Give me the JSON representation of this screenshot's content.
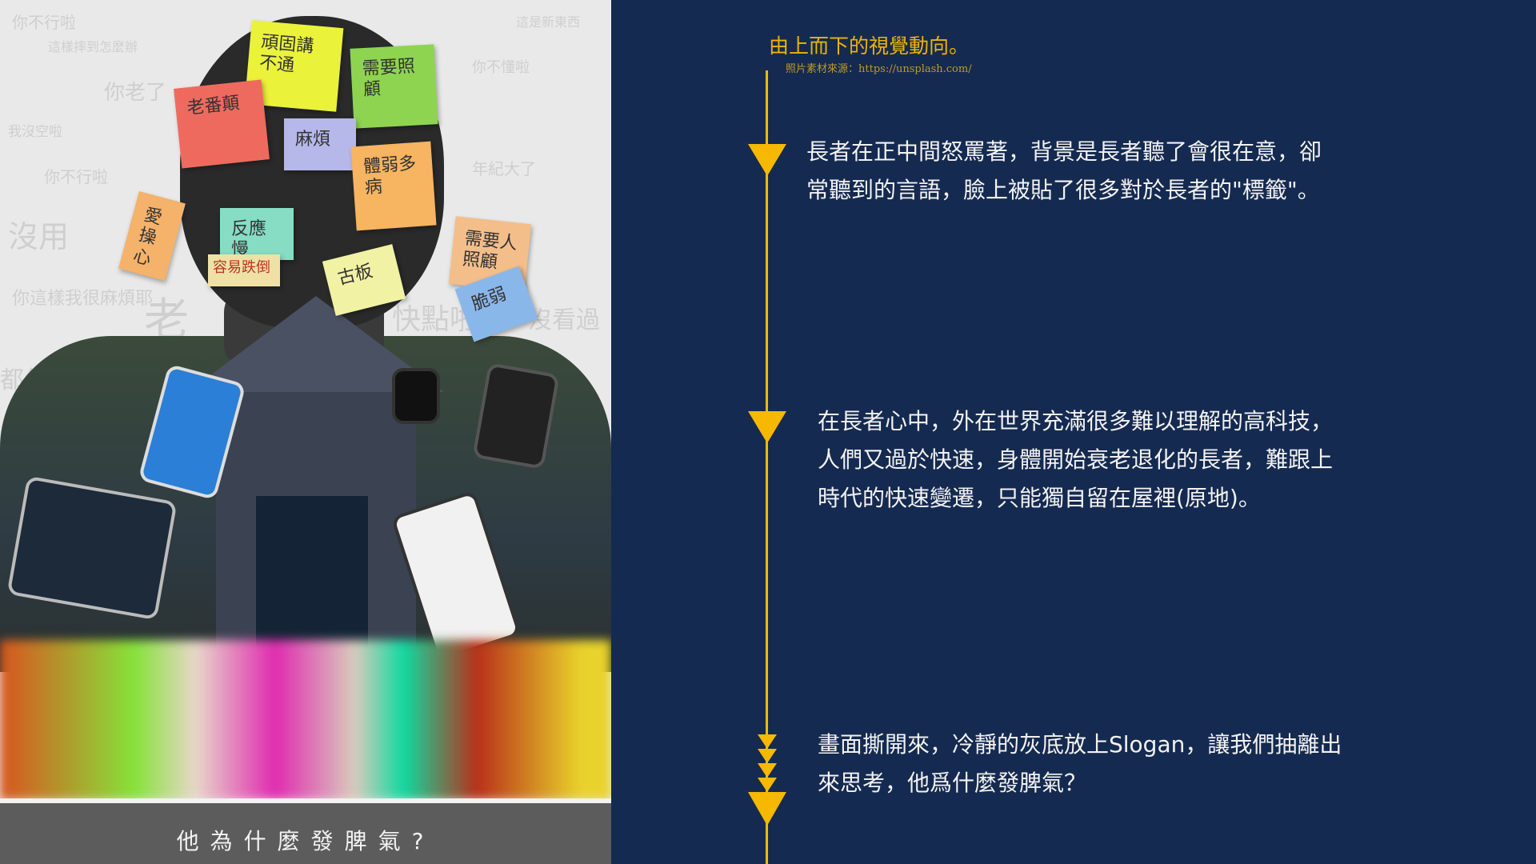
{
  "header": {
    "title": "由上而下的視覺動向。",
    "credit": "照片素材來源：https://unsplash.com/"
  },
  "steps": [
    {
      "lines": [
        "長者在正中間怒罵著，背景是長者聽了會很在意，卻",
        "常聽到的言語，臉上被貼了很多對於長者的\"標籤\"。"
      ]
    },
    {
      "lines": [
        "在長者心中，外在世界充滿很多難以理解的高科技，",
        "人們又過於快速，身體開始衰老退化的長者，難跟上",
        "時代的快速變遷，只能獨自留在屋裡(原地)。"
      ]
    },
    {
      "lines": [
        "畫面撕開來，冷靜的灰底放上Slogan，讓我們抽離出",
        "來思考，他爲什麼發脾氣？"
      ]
    }
  ],
  "artwork": {
    "caption": "他為什麼發脾氣?",
    "background_words": [
      "你不行啦",
      "這樣摔到怎麼辦",
      "你老了",
      "我沒空啦",
      "你不行啦",
      "沒用",
      "你這樣我很麻煩耶",
      "老",
      "快點啦",
      "沒看過",
      "都年紀大了",
      "你不懂啦",
      "年紀大了",
      "這是新東西"
    ],
    "sticky_notes": [
      "頑固講不通",
      "需要照顧",
      "老番顛",
      "麻煩",
      "體弱多病",
      "愛操心",
      "反應慢",
      "容易跌倒",
      "古板",
      "需要人照顧",
      "脆弱"
    ]
  },
  "colors": {
    "background": "#152a50",
    "accent": "#f6b800"
  }
}
